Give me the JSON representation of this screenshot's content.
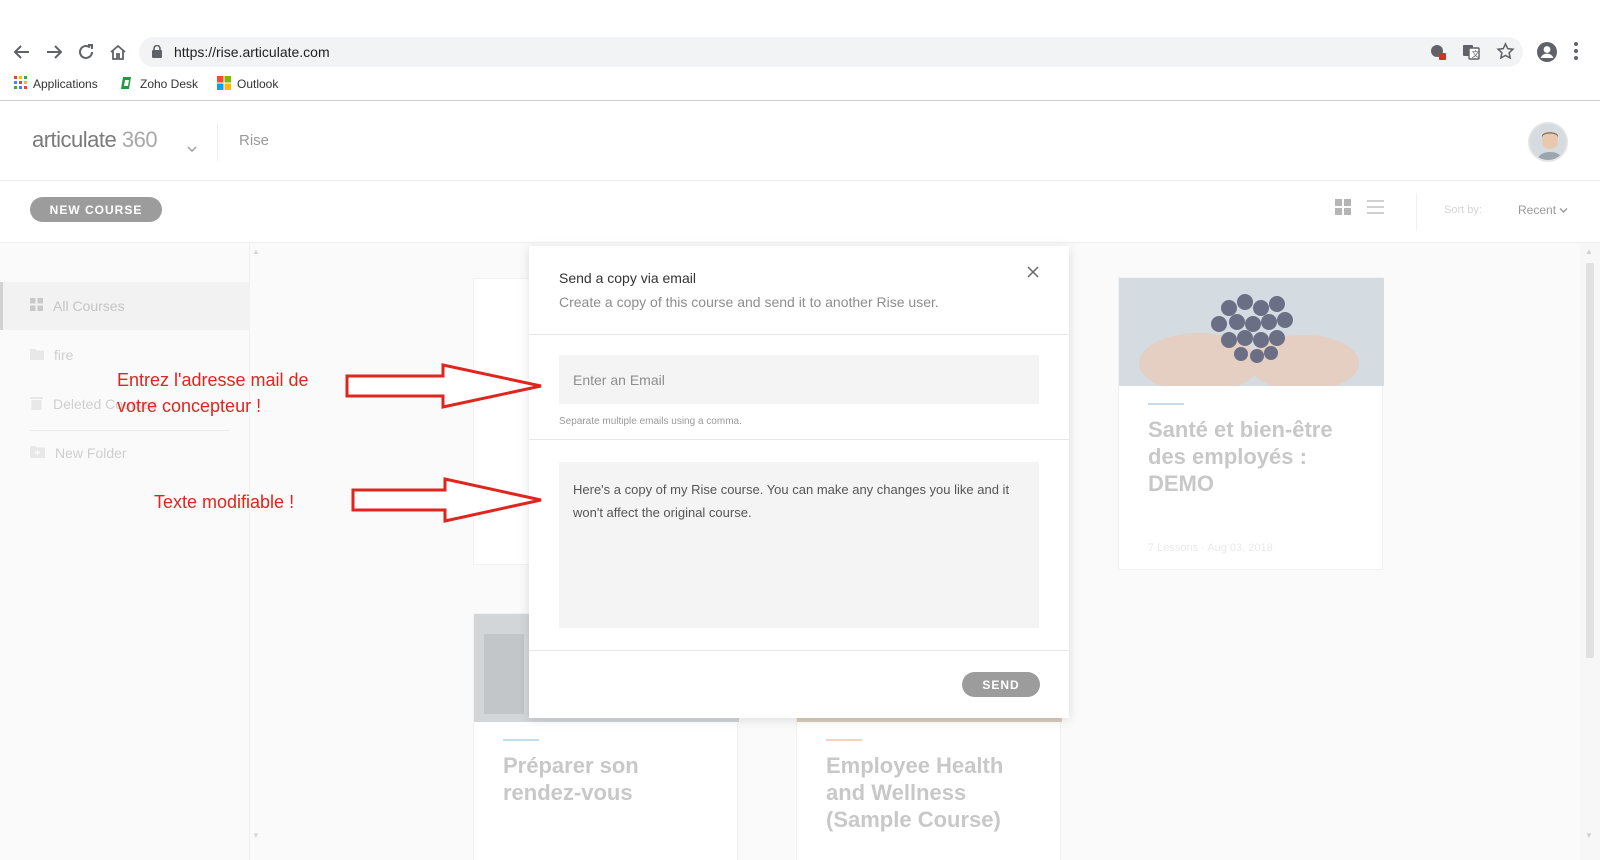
{
  "browser": {
    "url": "https://rise.articulate.com",
    "bookmarks": [
      {
        "label": "Applications",
        "icon": "apps-grid-icon"
      },
      {
        "label": "Zoho Desk",
        "icon": "zoho-desk-icon"
      },
      {
        "label": "Outlook",
        "icon": "microsoft-logo-icon"
      }
    ]
  },
  "app": {
    "logo_text": "articulate",
    "logo_num": "360",
    "product": "Rise",
    "new_course_label": "NEW COURSE",
    "sort_label": "Sort by:",
    "sort_value": "Recent"
  },
  "sidebar": {
    "items": [
      {
        "label": "All Courses",
        "icon": "grid-icon"
      },
      {
        "label": "fire",
        "icon": "folder-icon"
      },
      {
        "label": "Deleted Courses",
        "icon": "trash-icon"
      },
      {
        "label": "New Folder",
        "icon": "new-folder-icon"
      }
    ]
  },
  "cards": [
    {
      "title": "Santé et bien-être des employés : DEMO",
      "meta": "7 Lessons · Aug 03, 2018"
    },
    {
      "title": "Préparer son rendez-vous"
    },
    {
      "title": "Employee Health and Wellness (Sample Course)"
    }
  ],
  "modal": {
    "title": "Send a copy via email",
    "subtitle": "Create a copy of this course and send it to another Rise user.",
    "email_placeholder": "Enter an Email",
    "hint": "Separate multiple emails using a comma.",
    "message": "Here's a copy of my Rise course. You can make any changes you like and it won't affect the original course.",
    "send_label": "SEND"
  },
  "annotations": {
    "email_line1": "Entrez l'adresse mail de",
    "email_line2": "votre concepteur !",
    "text_note": "Texte modifiable !"
  },
  "colors": {
    "annotation": "#e0251e",
    "button": "#9c9c9c"
  }
}
